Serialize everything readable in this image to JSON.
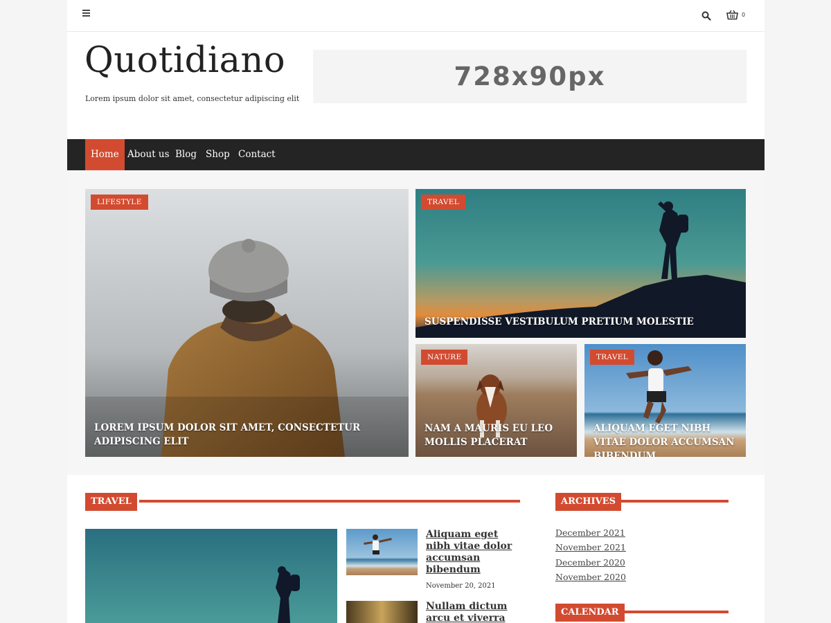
{
  "topbar": {
    "menu_icon": "hamburger-icon",
    "search_icon": "search-icon",
    "cart_icon": "basket-icon",
    "cart_count": "0"
  },
  "header": {
    "site_title": "Quotidiano",
    "tagline": "Lorem ipsum dolor sit amet, consectetur adipiscing elit",
    "ad_text": "728x90px"
  },
  "nav": {
    "items": [
      {
        "label": "Home",
        "active": true
      },
      {
        "label": "About us",
        "active": false
      },
      {
        "label": "Blog",
        "active": false
      },
      {
        "label": "Shop",
        "active": false
      },
      {
        "label": "Contact",
        "active": false
      }
    ]
  },
  "hero": {
    "posts": [
      {
        "category": "LIFESTYLE",
        "title": "LOREM IPSUM DOLOR SIT AMET, CONSECTETUR ADIPISCING ELIT"
      },
      {
        "category": "TRAVEL",
        "title": "SUSPENDISSE VESTIBULUM PRETIUM MOLESTIE"
      },
      {
        "category": "NATURE",
        "title": "NAM A MAURIS EU LEO MOLLIS PLACERAT"
      },
      {
        "category": "TRAVEL",
        "title": "ALIQUAM EGET NIBH VITAE DOLOR ACCUMSAN BIBENDUM"
      }
    ]
  },
  "travel_section": {
    "heading": "TRAVEL",
    "posts": [
      {
        "title": "Aliquam eget nibh vitae dolor accumsan bibendum",
        "date": "November 20, 2021"
      },
      {
        "title": "Nullam dictum arcu et viverra",
        "date": ""
      }
    ]
  },
  "sidebar": {
    "archives_heading": "ARCHIVES",
    "archives": [
      "December 2021",
      "November 2021",
      "December 2020",
      "November 2020"
    ],
    "calendar_heading": "CALENDAR"
  },
  "colors": {
    "accent": "#d24b30",
    "nav_bg": "#242424"
  }
}
